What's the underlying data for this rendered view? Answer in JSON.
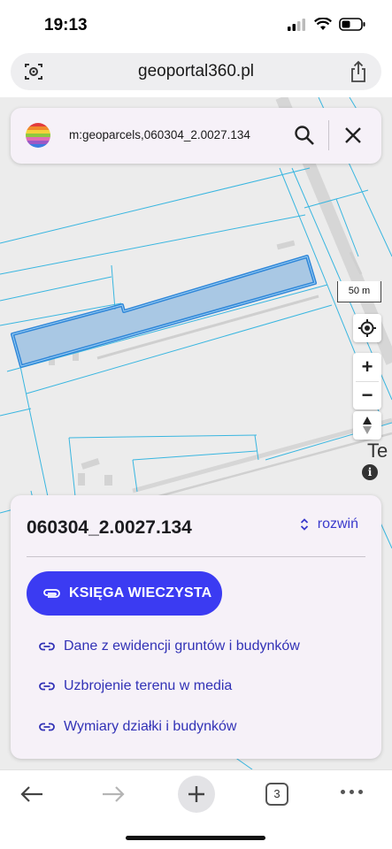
{
  "status_bar": {
    "time": "19:13"
  },
  "browser": {
    "url": "geoportal360.pl"
  },
  "search": {
    "query": "m:geoparcels,060304_2.0027.134"
  },
  "map": {
    "scale_label": "50 m",
    "place_label_fragment": "Te",
    "zoom_in_label": "+",
    "zoom_out_label": "−",
    "info_label": "i",
    "parcel_highlight_color": "#2f86d8"
  },
  "parcel_card": {
    "parcel_id": "060304_2.0027.134",
    "expand_label": "rozwiń",
    "primary_button_label": "KSIĘGA WIECZYSTA",
    "links": [
      "Dane z ewidencji gruntów i budynków",
      "Uzbrojenie terenu w media",
      "Wymiary działki i budynków"
    ]
  },
  "bottom_nav": {
    "tab_count": "3"
  },
  "colors": {
    "accent": "#3b3bf2",
    "link": "#3232b6",
    "card_bg": "#f6f1f8",
    "parcel_lines": "#39b6e0"
  }
}
